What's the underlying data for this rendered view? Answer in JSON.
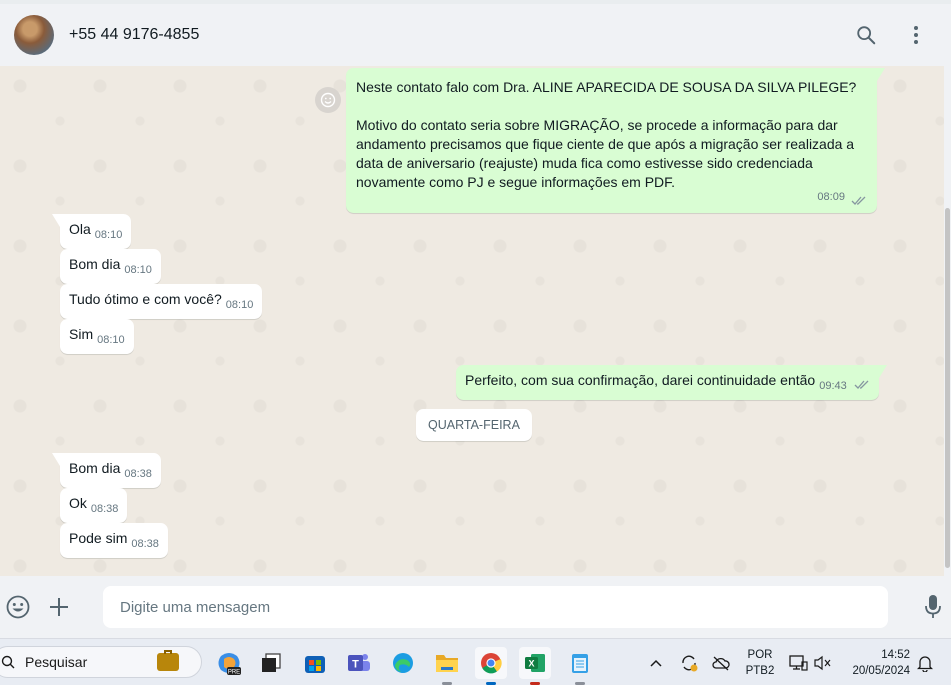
{
  "header": {
    "contact": "+55 44 9176-4855"
  },
  "messages": {
    "m1": {
      "line1": "Neste contato falo com Dra. ALINE APARECIDA DE SOUSA DA SILVA PILEGE?",
      "line2": "Motivo do contato seria sobre MIGRAÇÃO, se procede a informação para dar",
      "line3": "andamento precisamos que fique ciente de que após a migração ser realizada a",
      "line4": "data de aniversario (reajuste) muda fica como estivesse sido credenciada",
      "line5": "novamente como PJ e segue informações em PDF.",
      "time": "08:09"
    },
    "m2": {
      "text": "Ola",
      "time": "08:10"
    },
    "m3": {
      "text": "Bom dia",
      "time": "08:10"
    },
    "m4": {
      "text": "Tudo ótimo e com você?",
      "time": "08:10"
    },
    "m5": {
      "text": "Sim",
      "time": "08:10"
    },
    "m6": {
      "text": "Perfeito, com sua confirmação, darei continuidade então",
      "time": "09:43"
    },
    "date_divider": "QUARTA-FEIRA",
    "m7": {
      "text": "Bom dia",
      "time": "08:38"
    },
    "m8": {
      "text": "Ok",
      "time": "08:38"
    },
    "m9": {
      "text": "Pode sim",
      "time": "08:38"
    }
  },
  "composer": {
    "placeholder": "Digite uma mensagem"
  },
  "taskbar": {
    "search_label": "Pesquisar",
    "lang_top": "POR",
    "lang_bottom": "PTB2",
    "time": "14:52",
    "date": "20/05/2024"
  },
  "colors": {
    "outgoing_bubble": "#d9fdd3",
    "incoming_bubble": "#ffffff",
    "chat_background": "#efeae2",
    "read_ticks": "#8696a0"
  }
}
